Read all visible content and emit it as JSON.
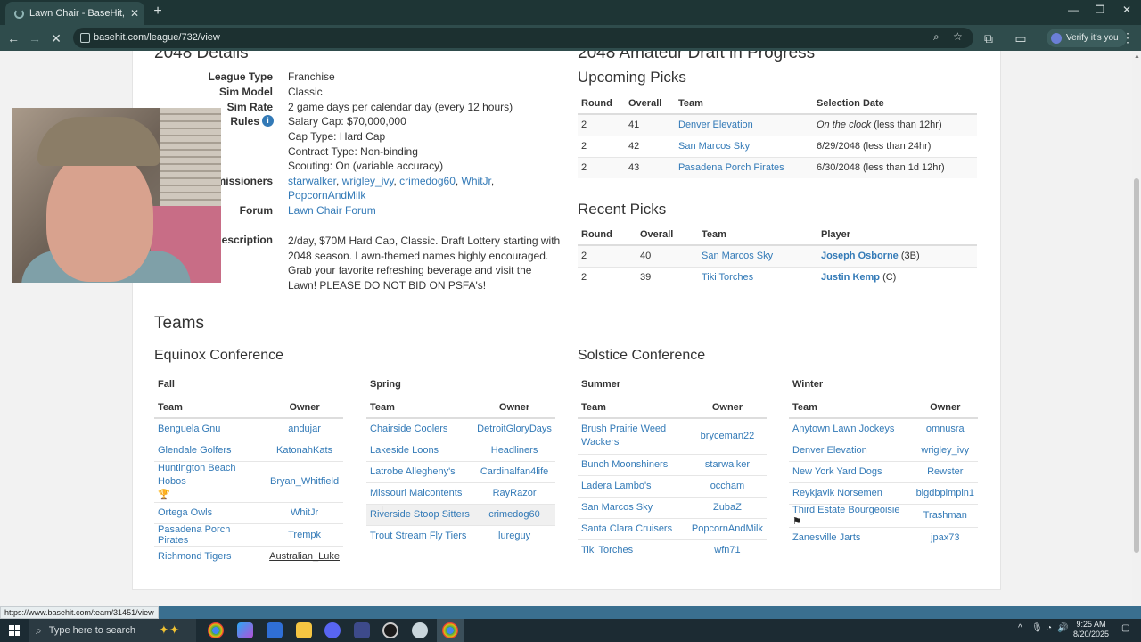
{
  "browser": {
    "tab_title": "Lawn Chair - BaseHit, a free sim",
    "url": "basehit.com/league/732/view",
    "verify_label": "Verify it's you",
    "status_url": "https://www.basehit.com/team/31451/view"
  },
  "details": {
    "heading": "2048 Details",
    "rows": [
      {
        "label": "League Type",
        "value": "Franchise"
      },
      {
        "label": "Sim Model",
        "value": "Classic"
      },
      {
        "label": "Sim Rate",
        "value": "2 game days per calendar day (every 12 hours)"
      },
      {
        "label": "Rules",
        "value": "Salary Cap: $70,000,000"
      }
    ],
    "rules_extra": [
      "Cap Type: Hard Cap",
      "Contract Type: Non-binding",
      "Scouting: On (variable accuracy)"
    ],
    "commissioners_label": "missioners",
    "commissioners": [
      "starwalker",
      "wrigley_ivy",
      "crimedog60",
      "WhitJr",
      "PopcornAndMilk"
    ],
    "forum_label": "Forum",
    "forum_value": "Lawn Chair Forum",
    "description_label": "escription",
    "description_lines": [
      "2/day, $70M Hard Cap, Classic. Draft Lottery starting with",
      "2048 season. Lawn-themed names highly encouraged.",
      "Grab your favorite refreshing beverage and visit the",
      "Lawn! PLEASE DO NOT BID ON PSFA's!"
    ]
  },
  "draft": {
    "heading": "2048 Amateur Draft in Progress",
    "upcoming_title": "Upcoming Picks",
    "upcoming_headers": [
      "Round",
      "Overall",
      "Team",
      "Selection Date"
    ],
    "upcoming": [
      {
        "round": "2",
        "overall": "41",
        "team": "Denver Elevation",
        "date_em": "On the clock",
        "date": " (less than 12hr)"
      },
      {
        "round": "2",
        "overall": "42",
        "team": "San Marcos Sky",
        "date_em": "",
        "date": "6/29/2048 (less than 24hr)"
      },
      {
        "round": "2",
        "overall": "43",
        "team": "Pasadena Porch Pirates",
        "date_em": "",
        "date": "6/30/2048 (less than 1d 12hr)"
      }
    ],
    "recent_title": "Recent Picks",
    "recent_headers": [
      "Round",
      "Overall",
      "Team",
      "Player"
    ],
    "recent": [
      {
        "round": "2",
        "overall": "40",
        "team": "San Marcos Sky",
        "player": "Joseph Osborne",
        "pos": " (3B)"
      },
      {
        "round": "2",
        "overall": "39",
        "team": "Tiki Torches",
        "player": "Justin Kemp",
        "pos": " (C)"
      }
    ]
  },
  "teams": {
    "heading": "Teams",
    "col_team": "Team",
    "col_owner": "Owner",
    "conferences": [
      {
        "name": "Equinox Conference",
        "divisions": [
          {
            "name": "Fall",
            "rows": [
              {
                "team": "Benguela Gnu",
                "owner": "andujar"
              },
              {
                "team": "Glendale Golfers",
                "owner": "KatonahKats"
              },
              {
                "team": "Huntington Beach Hobos",
                "owner": "Bryan_Whitfield"
              },
              {
                "team": "Ortega Owls",
                "owner": "WhitJr"
              },
              {
                "team": "Pasadena Porch Pirates",
                "owner": "Trempk"
              },
              {
                "team": "Richmond Tigers",
                "owner": "Australian_Luke"
              }
            ]
          },
          {
            "name": "Spring",
            "rows": [
              {
                "team": "Chairside Coolers",
                "owner": "DetroitGloryDays"
              },
              {
                "team": "Lakeside Loons",
                "owner": "Headliners"
              },
              {
                "team": "Latrobe Allegheny's",
                "owner": "Cardinalfan4life"
              },
              {
                "team": "Missouri Malcontents",
                "owner": "RayRazor"
              },
              {
                "team": "Riverside Stoop Sitters",
                "owner": "crimedog60"
              },
              {
                "team": "Trout Stream Fly Tiers",
                "owner": "lureguy"
              }
            ]
          }
        ]
      },
      {
        "name": "Solstice Conference",
        "divisions": [
          {
            "name": "Summer",
            "rows": [
              {
                "team": "Brush Prairie Weed Wackers",
                "owner": "bryceman22"
              },
              {
                "team": "Bunch Moonshiners",
                "owner": "starwalker"
              },
              {
                "team": "Ladera Lambo's",
                "owner": "occham"
              },
              {
                "team": "San Marcos Sky",
                "owner": "ZubaZ"
              },
              {
                "team": "Santa Clara Cruisers",
                "owner": "PopcornAndMilk"
              },
              {
                "team": "Tiki Torches",
                "owner": "wfn71"
              }
            ]
          },
          {
            "name": "Winter",
            "rows": [
              {
                "team": "Anytown Lawn Jockeys",
                "owner": "omnusra"
              },
              {
                "team": "Denver Elevation",
                "owner": "wrigley_ivy"
              },
              {
                "team": "New York Yard Dogs",
                "owner": "Rewster"
              },
              {
                "team": "Reykjavik Norsemen",
                "owner": "bigdbpimpin1"
              },
              {
                "team": "Third Estate Bourgeoisie",
                "owner": "Trashman"
              },
              {
                "team": "Zanesville Jarts",
                "owner": "jpax73"
              }
            ]
          }
        ]
      }
    ]
  },
  "taskbar": {
    "search_placeholder": "Type here to search",
    "time": "9:25 AM",
    "date": "8/20/2025"
  },
  "colors": {
    "link": "#337ab7",
    "chrome_bg": "#2f4c4c",
    "tabstrip_bg": "#1e3535",
    "taskbar_bg": "#1c2b33"
  }
}
